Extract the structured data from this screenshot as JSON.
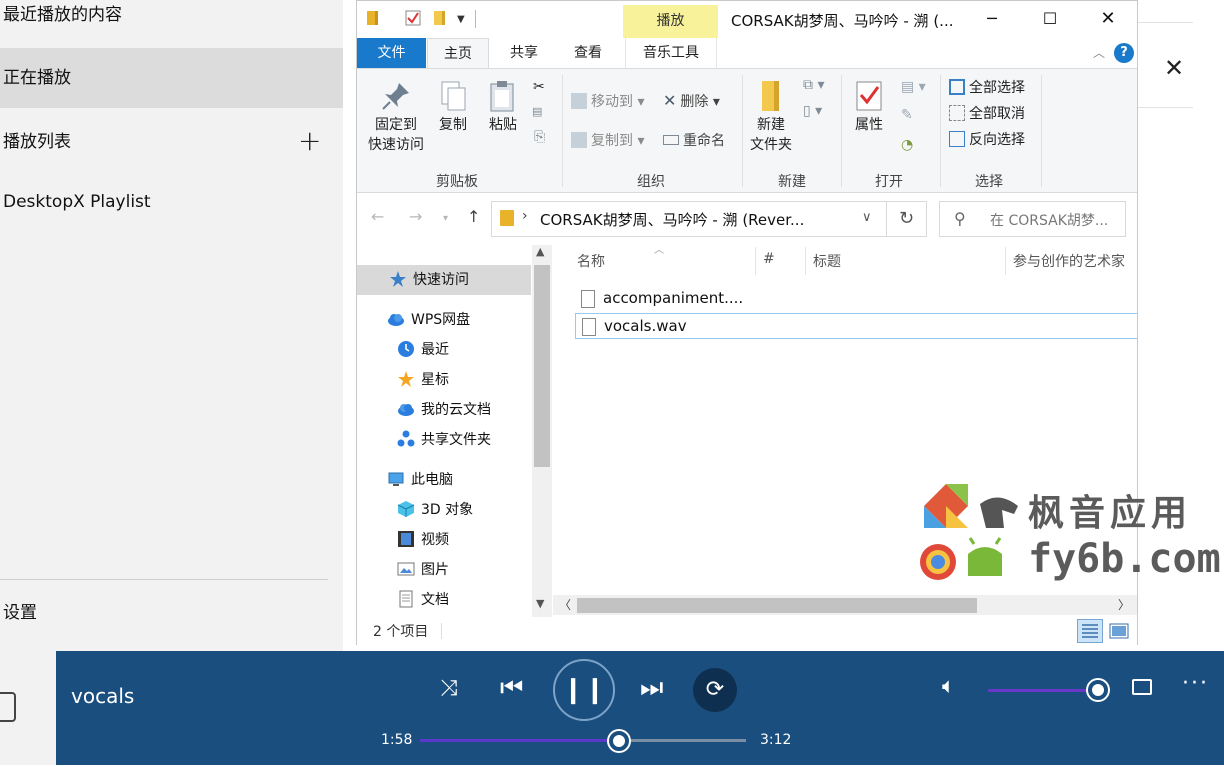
{
  "sidebar": {
    "recent": "最近播放的内容",
    "now_playing": "正在播放",
    "playlists": "播放列表",
    "add": "+",
    "playlist_items": [
      "DesktopX Playlist"
    ],
    "settings": "设置"
  },
  "explorer": {
    "context_tab": "播放",
    "title": "CORSAK胡梦周、马吟吟 - 溯 (...",
    "tabs": [
      "文件",
      "主页",
      "共享",
      "查看",
      "音乐工具"
    ],
    "ribbon": {
      "clipboard": {
        "label": "剪贴板",
        "pin": "固定到\n快速访问",
        "copy": "复制",
        "paste": "粘贴"
      },
      "organize": {
        "label": "组织",
        "move_to": "移动到",
        "copy_to": "复制到",
        "delete": "删除",
        "rename": "重命名"
      },
      "new": {
        "label": "新建",
        "new_folder": "新建\n文件夹"
      },
      "open": {
        "label": "打开",
        "properties": "属性"
      },
      "select": {
        "label": "选择",
        "select_all": "全部选择",
        "select_none": "全部取消",
        "invert": "反向选择"
      }
    },
    "address": "CORSAK胡梦周、马吟吟 - 溯 (Rever...",
    "search_placeholder": "在 CORSAK胡梦...",
    "nav_pane": [
      {
        "label": "快速访问",
        "icon": "star-icon"
      },
      {
        "label": "WPS网盘",
        "icon": "cloud-icon"
      },
      {
        "label": "最近",
        "icon": "clock-icon"
      },
      {
        "label": "星标",
        "icon": "star-icon"
      },
      {
        "label": "我的云文档",
        "icon": "cloud-icon"
      },
      {
        "label": "共享文件夹",
        "icon": "share-icon"
      },
      {
        "label": "此电脑",
        "icon": "computer-icon"
      },
      {
        "label": "3D 对象",
        "icon": "cube-icon"
      },
      {
        "label": "视频",
        "icon": "film-icon"
      },
      {
        "label": "图片",
        "icon": "image-icon"
      },
      {
        "label": "文档",
        "icon": "document-icon"
      }
    ],
    "columns": [
      "名称",
      "#",
      "标题",
      "参与创作的艺术家"
    ],
    "files": [
      "accompaniment....",
      "vocals.wav"
    ],
    "status": "2 个项目"
  },
  "watermark": {
    "line1": "枫音应用",
    "line2": "fy6b.com"
  },
  "player": {
    "track": "vocals",
    "elapsed": "1:58",
    "total": "3:12",
    "progress": 0.61,
    "volume": 1.0
  },
  "colors": {
    "accent": "#1979ca",
    "player_bg": "#1a4e7e",
    "seek_fill": "#5a38c9"
  }
}
